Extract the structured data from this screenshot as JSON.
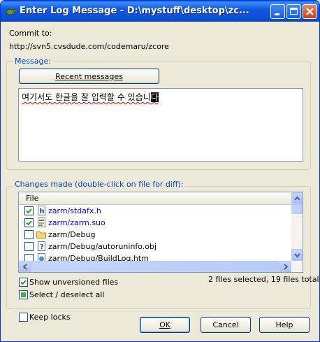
{
  "window": {
    "title": "Enter Log Message - D:\\mystuff\\desktop\\zc...",
    "controls": {
      "minimize_icon": "minimize-icon",
      "maximize_icon": "maximize-icon",
      "close_icon": "close-icon"
    }
  },
  "commit": {
    "label": "Commit to:",
    "url": "http://svn5.cvsdude.com/codemaru/zcore"
  },
  "message": {
    "group_label": "Message:",
    "recent_button": "Recent messages",
    "text": "여기서도 한글을 잘 입력할 수 있습니",
    "caret_char": "다"
  },
  "changes": {
    "group_label": "Changes made (double-click on file for diff):",
    "column_header": "File",
    "files": [
      {
        "name": "zarm/stdafx.h",
        "checked": true,
        "icon": "header-file-icon",
        "color": "#0000ff"
      },
      {
        "name": "zarm/zarm.suo",
        "checked": true,
        "icon": "suo-file-icon",
        "color": "#0000ff"
      },
      {
        "name": "zarm/Debug",
        "checked": false,
        "icon": "folder-icon",
        "color": "#000000"
      },
      {
        "name": "zarm/Debug/autoruninfo.obj",
        "checked": false,
        "icon": "unknown-file-icon",
        "color": "#000000"
      },
      {
        "name": "zarm/Debug/BuildLog.htm",
        "checked": false,
        "icon": "htm-file-icon",
        "color": "#000000"
      }
    ],
    "show_unversioned": {
      "label": "Show unversioned files",
      "checked": true
    },
    "select_all": {
      "label": "Select / deselect all",
      "state": "indeterminate"
    },
    "summary": "2 files selected, 19 files total"
  },
  "keep_locks": {
    "label": "Keep locks",
    "checked": false
  },
  "buttons": {
    "ok": "OK",
    "cancel": "Cancel",
    "help": "Help"
  },
  "colors": {
    "titlebar": "#0b4fd6",
    "group_label": "#0046d5",
    "dialog_bg": "#ece9d8",
    "modified_file": "#0000ff"
  }
}
